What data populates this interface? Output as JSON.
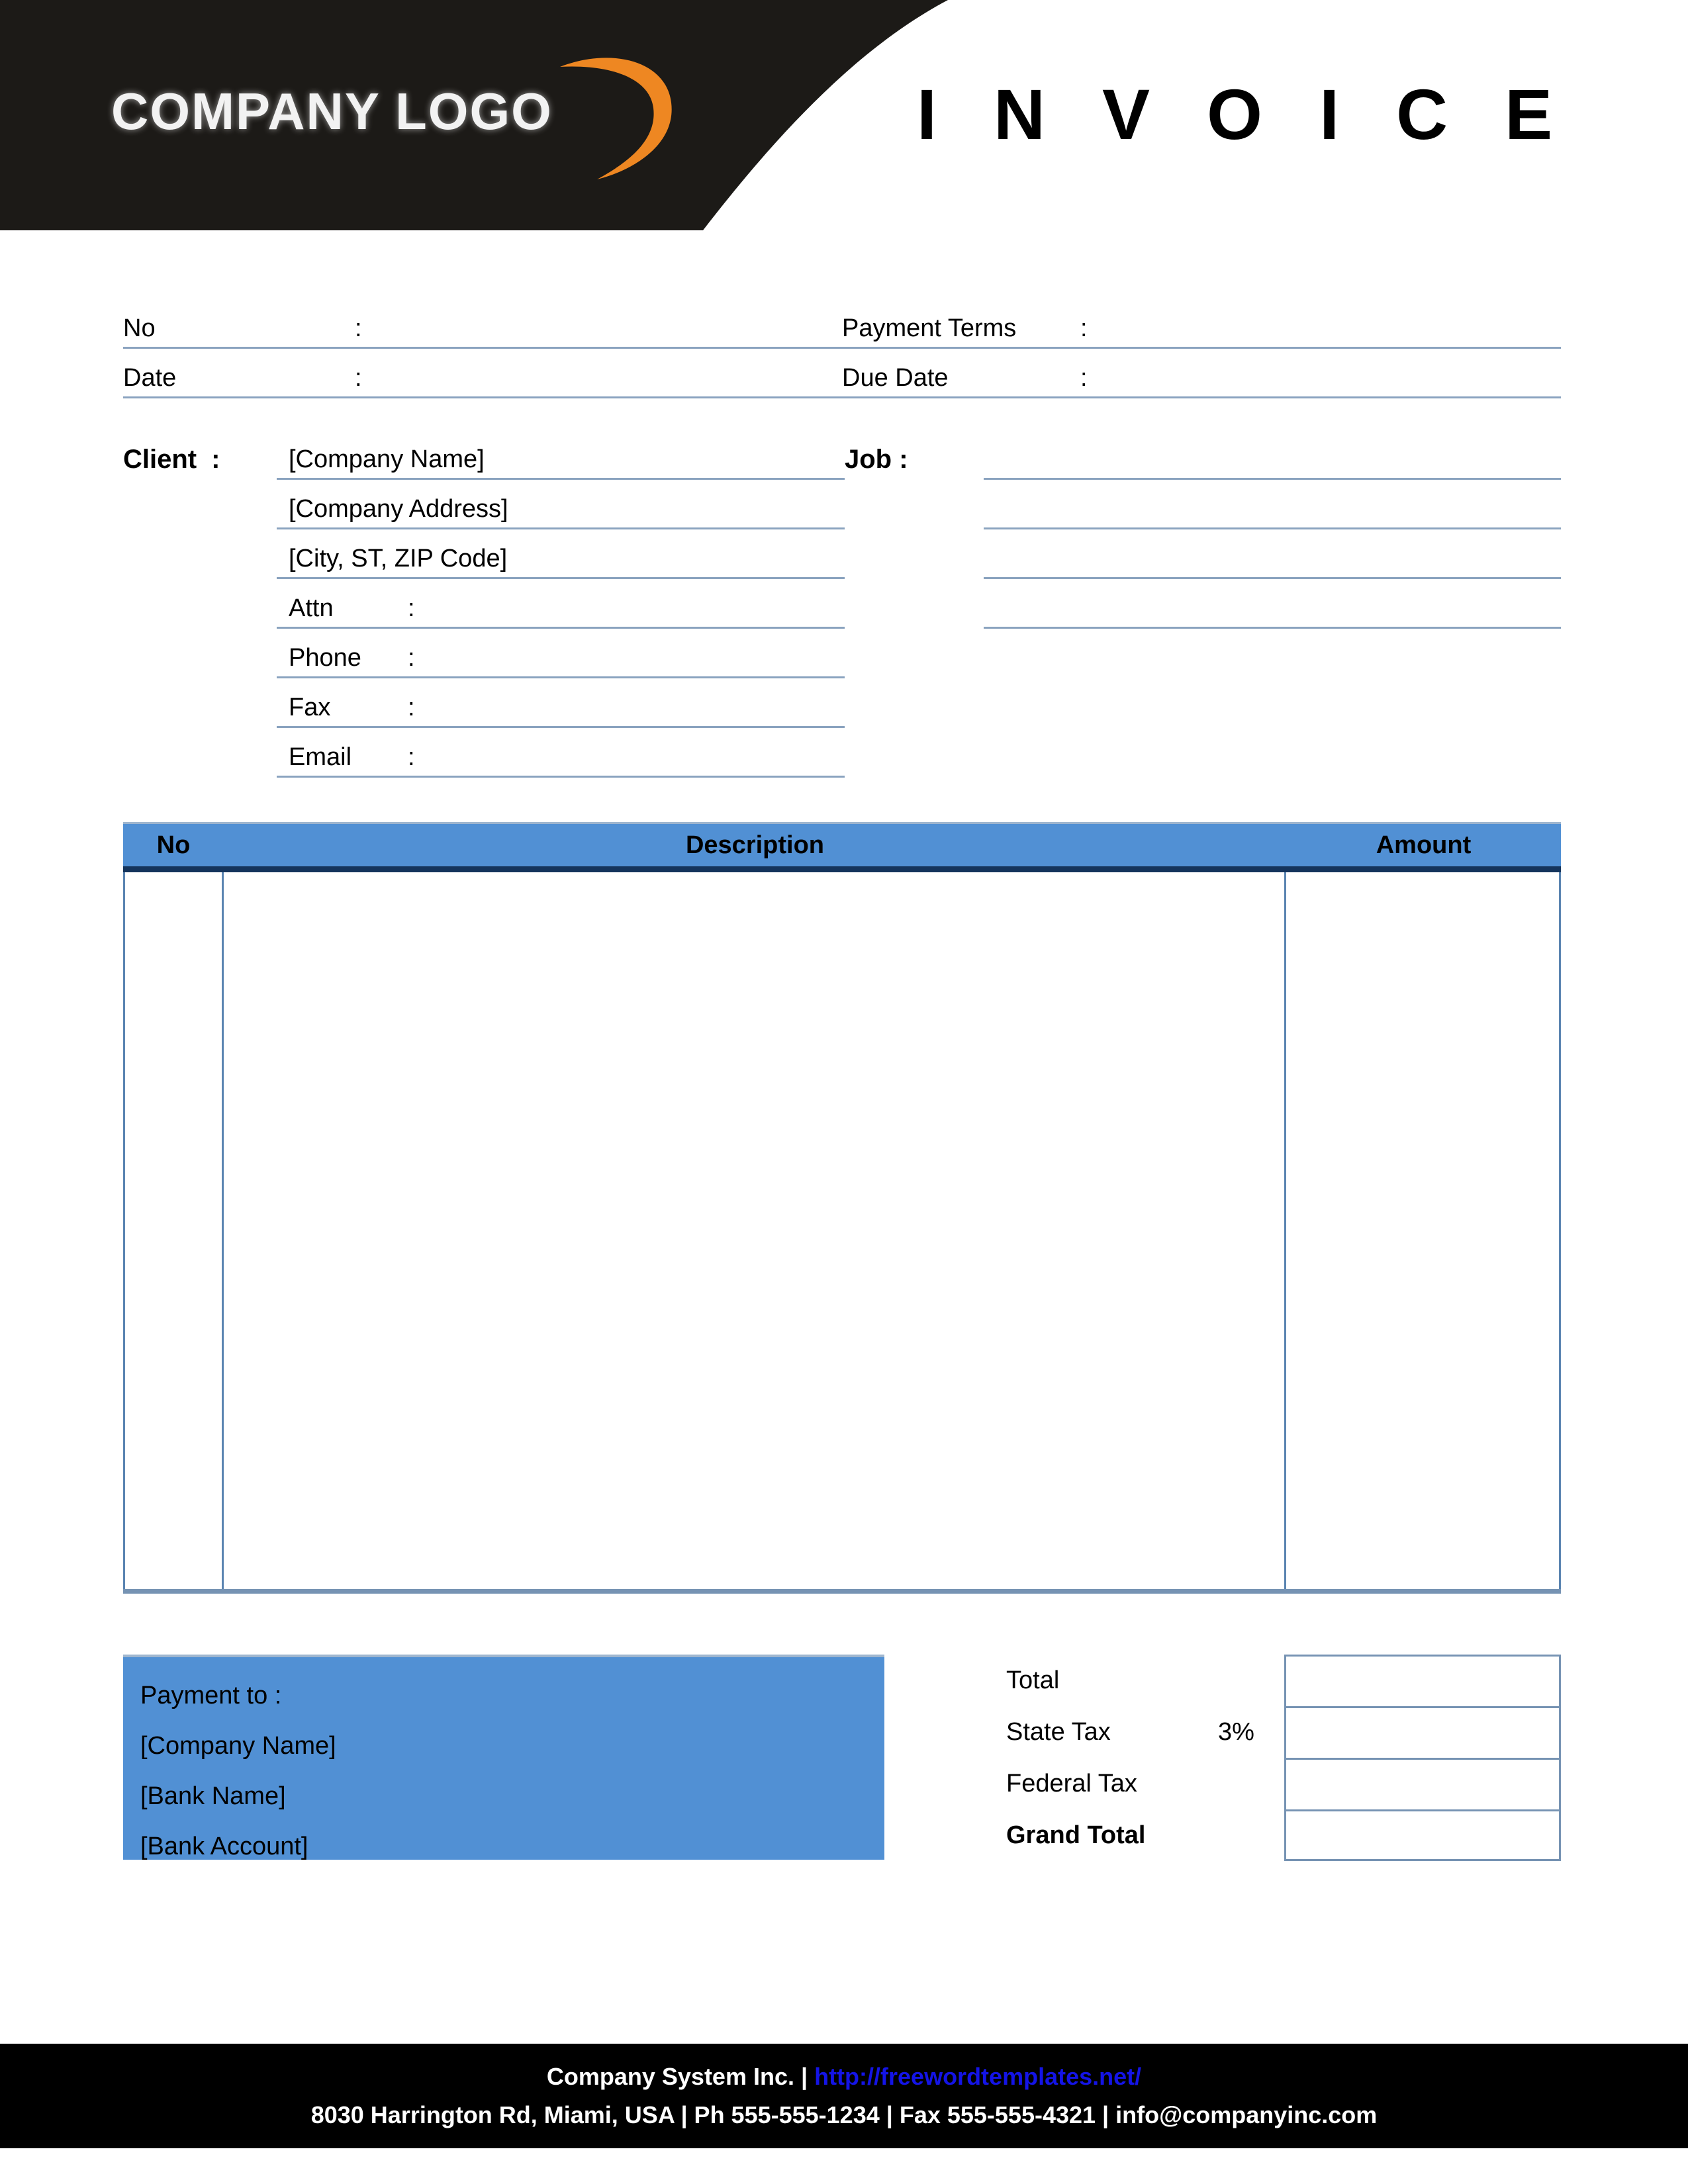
{
  "header": {
    "logo_text": "COMPANY LOGO",
    "logo_swoosh_color": "#EE8722",
    "band_color": "#1C1A17",
    "title": "I N V O I C E"
  },
  "meta": {
    "rows": [
      {
        "left_label": "No",
        "left_colon": ":",
        "right_label": "Payment  Terms",
        "right_colon": ":"
      },
      {
        "left_label": "Date",
        "left_colon": ":",
        "right_label": "Due Date",
        "right_colon": ":"
      }
    ]
  },
  "client": {
    "tag": "Client",
    "tag_colon": ":",
    "company_name": "[Company Name]",
    "company_address": "[Company Address]",
    "city_st_zip": "[City, ST, ZIP Code]",
    "fields": [
      {
        "label": "Attn",
        "colon": ":",
        "value": ""
      },
      {
        "label": "Phone",
        "colon": ":",
        "value": ""
      },
      {
        "label": "Fax",
        "colon": ":",
        "value": ""
      },
      {
        "label": "Email",
        "colon": ":",
        "value": ""
      }
    ]
  },
  "job": {
    "tag": "Job",
    "tag_colon": ":",
    "lines": [
      "",
      "",
      "",
      ""
    ]
  },
  "items": {
    "columns": [
      "No",
      "Description",
      "Amount"
    ],
    "header_bg": "#5190D4",
    "header_rule": "#14345c",
    "rows": []
  },
  "payment_to": {
    "heading": "Payment to :",
    "company_name": "[Company Name]",
    "bank_name": "[Bank Name]",
    "bank_account": "[Bank Account]",
    "bg": "#5190D4"
  },
  "totals": {
    "rows": [
      {
        "label": "Total",
        "rate": "",
        "value": ""
      },
      {
        "label": "State Tax",
        "rate": "3%",
        "value": ""
      },
      {
        "label": "Federal Tax",
        "rate": "",
        "value": ""
      },
      {
        "label": "Grand Total",
        "rate": "",
        "value": ""
      }
    ]
  },
  "footer": {
    "company": "Company System Inc. |",
    "url": "http://freewordtemplates.net/",
    "address_line": "8030 Harrington Rd, Miami, USA | Ph 555-555-1234 | Fax 555-555-4321 | info@companyinc.com",
    "bg": "#000000",
    "url_color": "#1414e6"
  }
}
